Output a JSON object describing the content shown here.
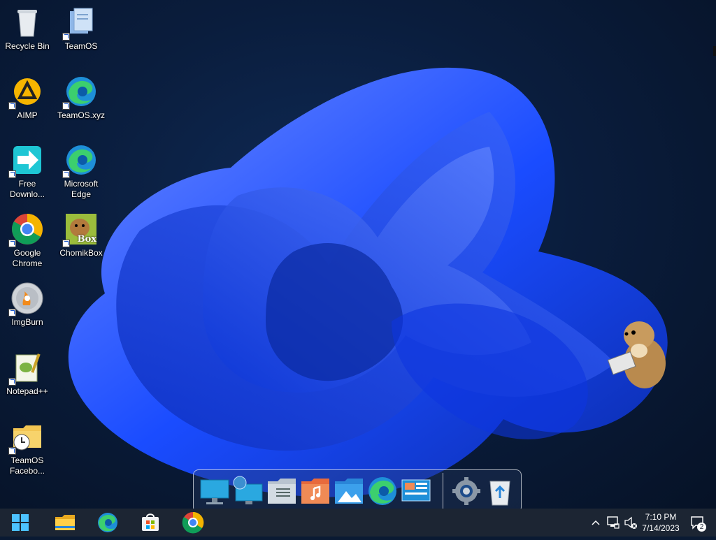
{
  "desktop": {
    "icons": [
      {
        "label": "Recycle Bin",
        "icon": "recycle-bin-icon"
      },
      {
        "label": "TeamOS",
        "icon": "teamos-folder-icon"
      },
      {
        "label": "AIMP",
        "icon": "aimp-icon"
      },
      {
        "label": "TeamOS.xyz",
        "icon": "edge-icon"
      },
      {
        "label": "Free Downlo...",
        "icon": "free-download-manager-icon"
      },
      {
        "label": "Microsoft Edge",
        "icon": "edge-icon"
      },
      {
        "label": "Google Chrome",
        "icon": "chrome-icon"
      },
      {
        "label": "ChomikBox",
        "icon": "chomikbox-icon"
      },
      {
        "label": "ImgBurn",
        "icon": "imgburn-icon"
      },
      {
        "label": "Notepad++",
        "icon": "notepadpp-icon"
      },
      {
        "label": "TeamOS Facebo...",
        "icon": "folder-clock-icon"
      }
    ],
    "chomikbox_badge": "Box"
  },
  "dock": {
    "items": [
      "monitor-icon",
      "network-globe-icon",
      "documents-folder-icon",
      "music-folder-icon",
      "pictures-folder-icon",
      "edge-icon",
      "control-panel-icon",
      "settings-gear-icon",
      "recycle-bin-icon"
    ]
  },
  "taskbar": {
    "pinned": [
      "start-icon",
      "file-explorer-icon",
      "edge-icon",
      "microsoft-store-icon",
      "chrome-icon"
    ],
    "tray": {
      "time": "7:10 PM",
      "date": "7/14/2023",
      "notification_count": "2"
    }
  },
  "colors": {
    "taskbar": "#1c2533",
    "wallpaper_blue": "#1a4cff",
    "wallpaper_bg": "#0a1d3d"
  }
}
